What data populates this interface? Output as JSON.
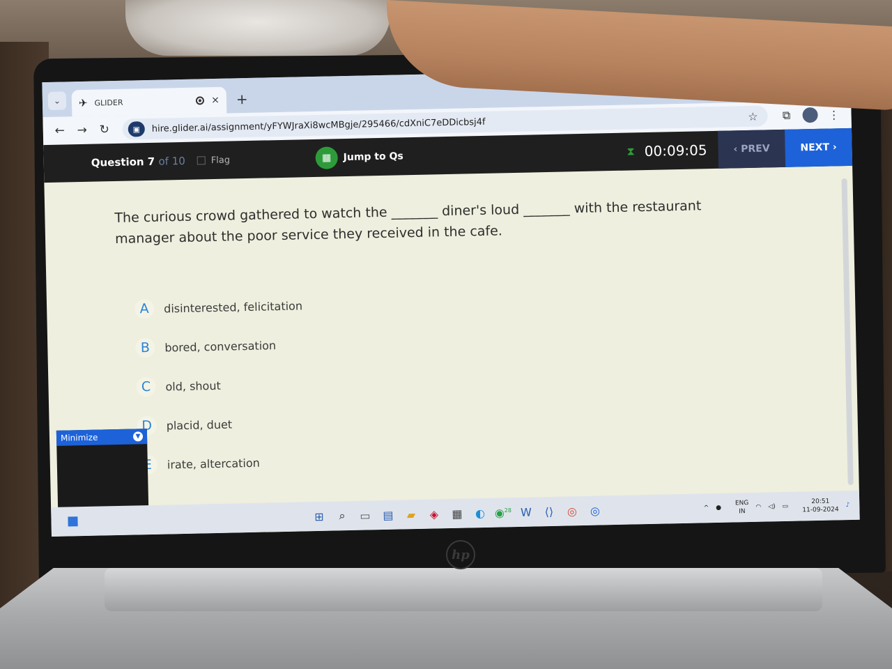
{
  "browser": {
    "tab_title": "GLIDER",
    "new_tab": "+",
    "tab_close": "×",
    "url": "hire.glider.ai/assignment/yFYWJraXi8wcMBgje/295466/cdXniC7eDDicbsj4f"
  },
  "header": {
    "question_label": "Question 7",
    "question_of": "of 10",
    "flag_label": "Flag",
    "jump_label": "Jump to Qs",
    "timer": "00:09:05",
    "prev_label": "PREV",
    "next_label": "NEXT"
  },
  "question": {
    "text": "The curious crowd gathered to watch the _______ diner's loud _______ with the restaurant manager about the poor service they received in the cafe."
  },
  "options": [
    {
      "letter": "A",
      "text": "disinterested, felicitation"
    },
    {
      "letter": "B",
      "text": "bored, conversation"
    },
    {
      "letter": "C",
      "text": "old, shout"
    },
    {
      "letter": "D",
      "text": "placid, duet"
    },
    {
      "letter": "E",
      "text": "irate, altercation"
    }
  ],
  "panel": {
    "minimize_label": "Minimize"
  },
  "taskbar": {
    "lang_top": "ENG",
    "lang_bottom": "IN",
    "time": "20:51",
    "date": "11-09-2024",
    "badge": "28"
  },
  "colors": {
    "accent": "#1d62d8",
    "green": "#2e9b3a",
    "letter": "#2a84d6"
  },
  "laptop": {
    "brand": "hp"
  }
}
